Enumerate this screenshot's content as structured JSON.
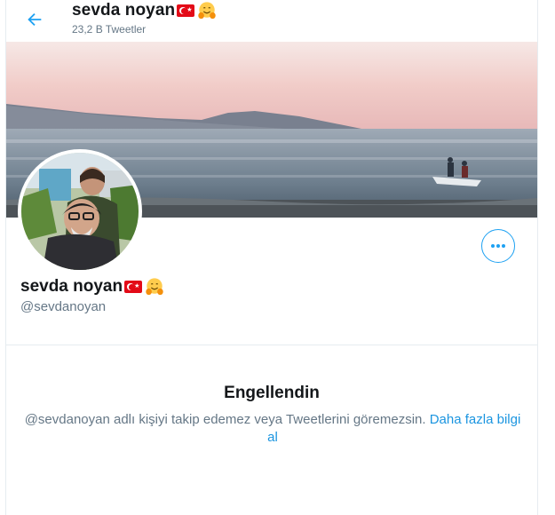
{
  "header": {
    "name": "sevda noyan",
    "tweet_count": "23,2 B Tweetler"
  },
  "profile": {
    "name": "sevda noyan",
    "handle": "@sevdanoyan"
  },
  "blocked": {
    "title": "Engellendin",
    "message": "@sevdanoyan adlı kişiyi takip edemez veya Tweetlerini göremezsin.",
    "link": "Daha fazla bilgi al"
  },
  "icons": {
    "back": "back-arrow-icon",
    "more": "more-options-icon",
    "flag": "turkey-flag-icon",
    "emoji": "hugging-face-emoji-icon"
  },
  "colors": {
    "accent": "#1da1f2",
    "secondary_text": "#657786",
    "primary_text": "#14171a",
    "link": "#1b95e0"
  }
}
